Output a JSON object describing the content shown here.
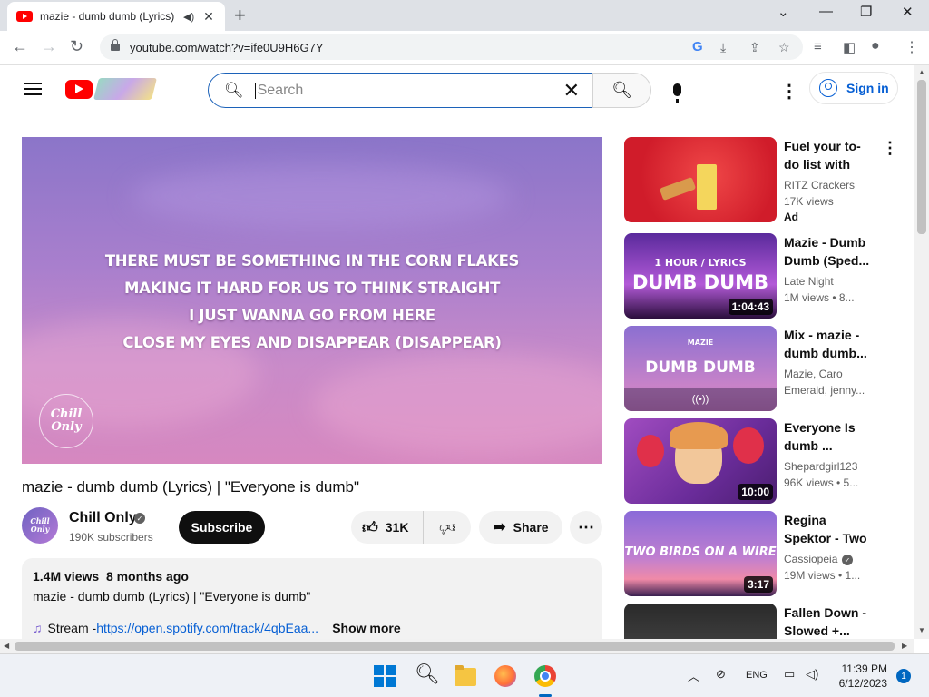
{
  "browser": {
    "tab_title": "mazie - dumb dumb (Lyrics)",
    "url": "youtube.com/watch?v=ife0U9H6G7Y"
  },
  "header": {
    "search_placeholder": "Search",
    "signin_label": "Sign in"
  },
  "player": {
    "lyrics": [
      "THERE MUST BE SOMETHING IN THE CORN FLAKES",
      "MAKING IT HARD FOR US TO THINK STRAIGHT",
      "I JUST WANNA GO FROM HERE",
      "CLOSE MY EYES AND DISAPPEAR (DISAPPEAR)"
    ],
    "watermark_line1": "Chill",
    "watermark_line2": "Only"
  },
  "video": {
    "title": "mazie - dumb dumb (Lyrics) | \"Everyone is dumb\"",
    "channel": "Chill Only",
    "subscribers": "190K subscribers",
    "subscribe_label": "Subscribe",
    "likes": "31K",
    "share_label": "Share",
    "views": "1.4M views",
    "age": "8 months ago",
    "description_line": "mazie - dumb dumb (Lyrics) | \"Everyone is dumb\"",
    "stream_label": "Stream - ",
    "stream_link": "https://open.spotify.com/track/4qbEaa...",
    "show_more": "Show more"
  },
  "recommendations": [
    {
      "title": "Fuel your to-do list with RITZ...",
      "channel": "RITZ Crackers",
      "meta": "17K views",
      "badge": "Ad",
      "duration": "",
      "thumb_text": ""
    },
    {
      "title": "Mazie - Dumb Dumb (Sped...",
      "channel": "Late Night",
      "meta": "1M views • 8...",
      "badge": "",
      "duration": "1:04:43",
      "thumb_text_small": "1 HOUR / LYRICS",
      "thumb_text": "DUMB DUMB"
    },
    {
      "title": "Mix - mazie - dumb dumb...",
      "channel": "Mazie, Caro",
      "meta": "Emerald, jenny...",
      "badge": "",
      "duration": "",
      "thumb_text_small": "MAZIE",
      "thumb_text": "DUMB DUMB"
    },
    {
      "title": "Everyone Is dumb ...",
      "channel": "Shepardgirl123",
      "meta": "96K views • 5...",
      "badge": "",
      "duration": "10:00",
      "thumb_text": ""
    },
    {
      "title": "Regina Spektor - Two Birds O...",
      "channel": "Cassiopeia",
      "meta": "19M views • 1...",
      "badge": "",
      "duration": "3:17",
      "thumb_text": "TWO BIRDS ON A WIRE"
    },
    {
      "title": "Fallen Down - Slowed +...",
      "channel": "",
      "meta": "",
      "badge": "",
      "duration": "",
      "thumb_text": ""
    }
  ],
  "taskbar": {
    "language": "ENG",
    "time": "11:39 PM",
    "date": "6/12/2023",
    "notifications": "1"
  }
}
